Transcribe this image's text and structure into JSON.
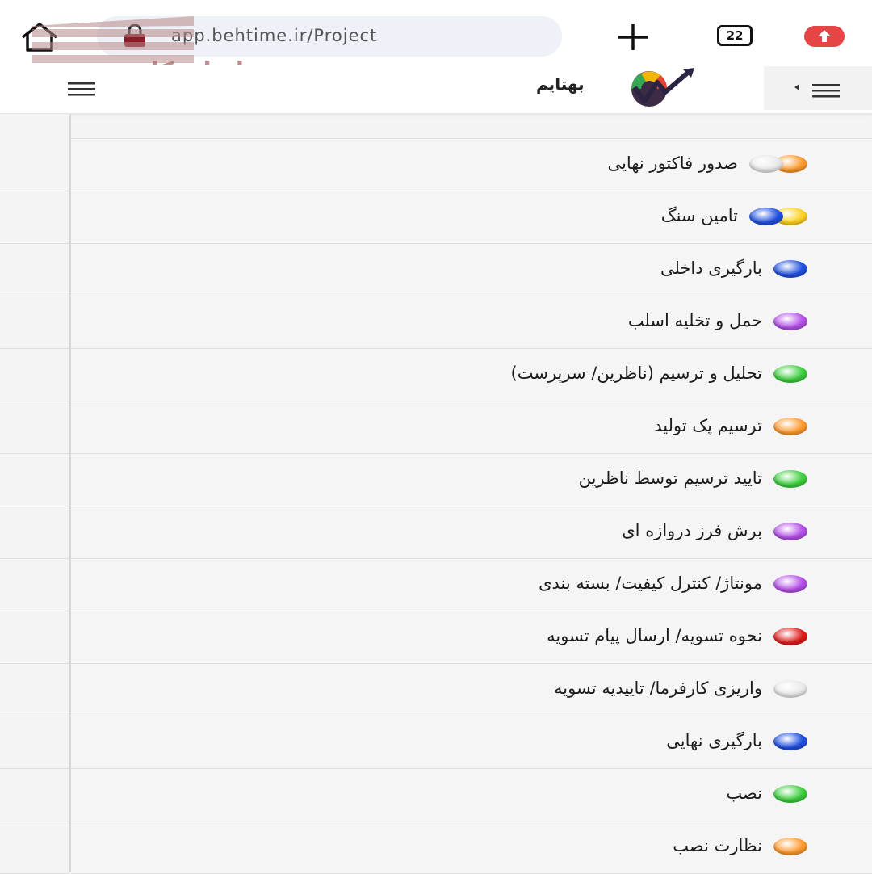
{
  "browser": {
    "url": "app.behtime.ir/Project",
    "tab_count": "22"
  },
  "watermark": {
    "text": "ایران کانتر"
  },
  "header": {
    "brand": "بهتایم"
  },
  "colors": {
    "orange": "#ff9a2e",
    "white": "#e9e9e9",
    "yellow": "#ffd21f",
    "blue": "#1f4fe0",
    "purple": "#b44fe8",
    "green": "#3ccf3c",
    "red": "#e01d1d"
  },
  "stages": [
    {
      "label": "صدور فاکتور نهایی",
      "dots": [
        "#ff9a2e",
        "#e9e9e9"
      ]
    },
    {
      "label": "تامین سنگ",
      "dots": [
        "#ffd21f",
        "#1f4fe0"
      ]
    },
    {
      "label": "بارگیری داخلی",
      "dots": [
        "#1f4fe0"
      ]
    },
    {
      "label": "حمل و تخلیه اسلب",
      "dots": [
        "#b44fe8"
      ]
    },
    {
      "label": "تحلیل و ترسیم (ناظرین/ سرپرست)",
      "dots": [
        "#3ccf3c"
      ]
    },
    {
      "label": "ترسیم پک تولید",
      "dots": [
        "#ff9a2e"
      ]
    },
    {
      "label": "تایید ترسیم توسط ناظرین",
      "dots": [
        "#3ccf3c"
      ]
    },
    {
      "label": "برش فرز دروازه ای",
      "dots": [
        "#b44fe8"
      ]
    },
    {
      "label": "مونتاژ/ کنترل کیفیت/ بسته بندی",
      "dots": [
        "#b44fe8"
      ]
    },
    {
      "label": "نحوه تسویه/ ارسال پیام تسویه",
      "dots": [
        "#e01d1d"
      ]
    },
    {
      "label": "واریزی کارفرما/ تاییدیه تسویه",
      "dots": [
        "#e9e9e9"
      ]
    },
    {
      "label": "بارگیری نهایی",
      "dots": [
        "#1f4fe0"
      ]
    },
    {
      "label": "نصب",
      "dots": [
        "#3ccf3c"
      ]
    },
    {
      "label": "نظارت نصب",
      "dots": [
        "#ff9a2e"
      ]
    }
  ]
}
